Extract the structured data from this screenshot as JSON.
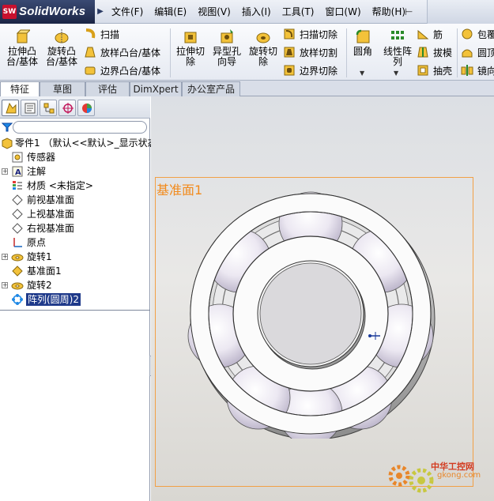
{
  "app": {
    "logo_text": "SolidWorks",
    "logo_badge": "SW"
  },
  "menubar": {
    "items": [
      "文件(F)",
      "编辑(E)",
      "视图(V)",
      "插入(I)",
      "工具(T)",
      "窗口(W)",
      "帮助(H)"
    ]
  },
  "commands": {
    "extrude_boss": [
      "拉伸凸",
      "台/基体"
    ],
    "revolve_boss": [
      "旋转凸",
      "台/基体"
    ],
    "sweep": "扫描",
    "loft_boss": "放样凸台/基体",
    "boundary_boss": "边界凸台/基体",
    "extrude_cut": [
      "拉伸切",
      "除"
    ],
    "hole_wizard": [
      "异型孔",
      "向导"
    ],
    "revolve_cut": [
      "旋转切",
      "除"
    ],
    "sweep_cut": "扫描切除",
    "loft_cut": "放样切割",
    "boundary_cut": "边界切除",
    "fillet": "圆角",
    "linear_pattern": [
      "线性阵",
      "列"
    ],
    "rib": "筋",
    "draft": "拔模",
    "shell": "抽壳",
    "wrap": "包覆",
    "dome": "圆顶",
    "mirror": "镜向"
  },
  "tabs": [
    "特征",
    "草图",
    "评估",
    "DimXpert",
    "办公室产品"
  ],
  "tree": {
    "root": "零件1  （默认<<默认>_显示状态",
    "items": [
      "传感器",
      "注解",
      "材质 <未指定>",
      "前视基准面",
      "上视基准面",
      "右视基准面",
      "原点",
      "旋转1",
      "基准面1",
      "旋转2",
      "阵列(圆周)2"
    ]
  },
  "graphics": {
    "plane_label": "基准面1",
    "watermark_cn": "中华工控网",
    "watermark_url": "gkong.com"
  },
  "colors": {
    "accent_orange": "#f28a1b",
    "selection": "#1f3a8a",
    "logo_red": "#c8102e"
  }
}
